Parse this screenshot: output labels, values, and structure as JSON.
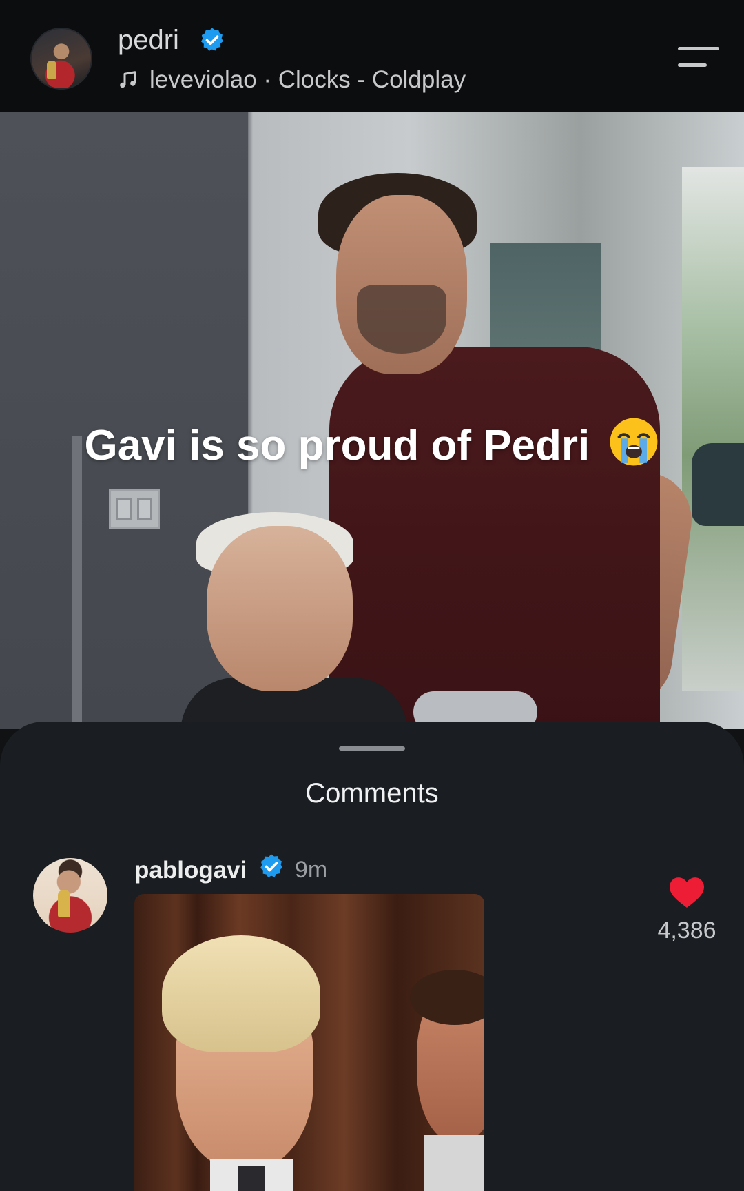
{
  "header": {
    "username": "pedri",
    "verified_icon": "verified-badge-icon",
    "music_icon": "music-note-icon",
    "music_text": "leveviolao · Clocks - Coldplay",
    "menu_icon": "menu-icon"
  },
  "video": {
    "caption": "Gavi is so proud of Pedri",
    "caption_emoji": "loudly-crying-face-emoji"
  },
  "comments": {
    "title": "Comments",
    "items": [
      {
        "username": "pablogavi",
        "verified": true,
        "time": "9m",
        "likes": "4,386",
        "liked": true
      }
    ]
  },
  "colors": {
    "verified_blue": "#1d9bf0",
    "like_red": "#ee1d36",
    "sheet_bg": "#1a1d21",
    "topbar_bg": "#0c0d0f"
  }
}
